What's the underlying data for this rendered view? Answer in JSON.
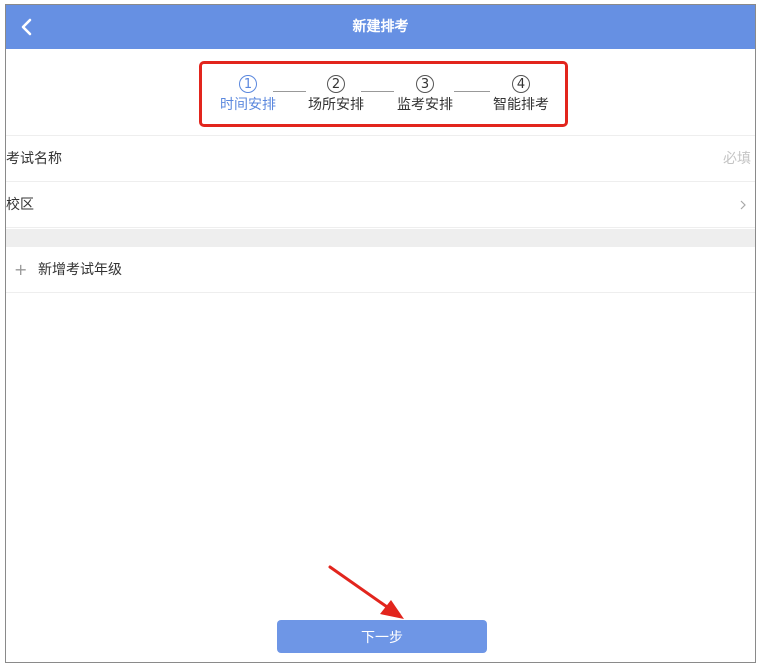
{
  "header": {
    "title": "新建排考",
    "back_icon": "chevron-left-icon"
  },
  "steps": [
    {
      "num": "1",
      "label": "时间安排",
      "active": true
    },
    {
      "num": "2",
      "label": "场所安排",
      "active": false
    },
    {
      "num": "3",
      "label": "监考安排",
      "active": false
    },
    {
      "num": "4",
      "label": "智能排考",
      "active": false
    }
  ],
  "form": {
    "exam_name_label": "考试名称",
    "exam_name_placeholder": "必填",
    "campus_label": "校区",
    "campus_icon": "chevron-right-icon"
  },
  "add_grade": {
    "icon": "plus-icon",
    "label": "新增考试年级"
  },
  "footer": {
    "next_label": "下一步"
  },
  "colors": {
    "header_bg": "#6690e3",
    "active_step": "#5b88de",
    "highlight_box": "#e2251d",
    "button_bg": "#6e96e6"
  }
}
